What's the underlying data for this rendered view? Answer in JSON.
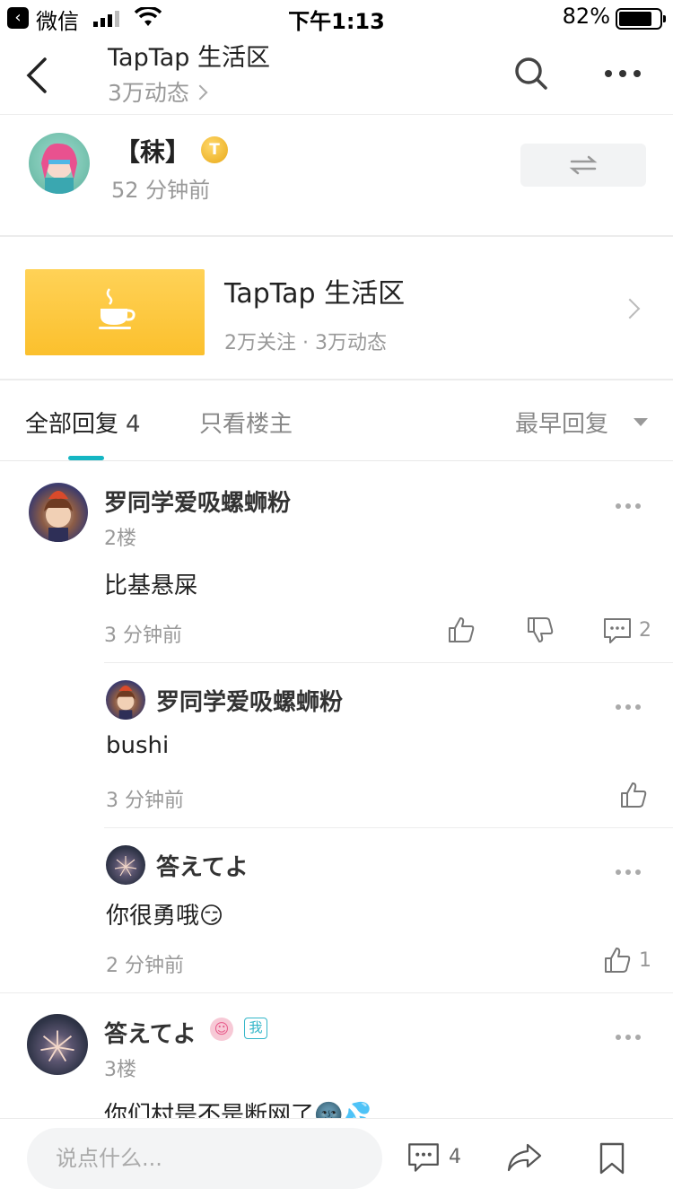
{
  "status_bar": {
    "back_app": "微信",
    "time": "下午1:13",
    "battery_pct": "82%",
    "battery_level": 0.82
  },
  "header": {
    "title": "TapTap 生活区",
    "subtitle": "3万动态"
  },
  "author": {
    "name": "【秣】",
    "badge": "T",
    "time": "52 分钟前"
  },
  "forum": {
    "title": "TapTap 生活区",
    "meta": "2万关注 · 3万动态"
  },
  "tabs": {
    "all": "全部回复",
    "all_count": "4",
    "owner_only": "只看楼主",
    "sort": "最早回复"
  },
  "comments": [
    {
      "user": "罗同学爱吸螺蛳粉",
      "floor": "2楼",
      "text": "比基悬屎",
      "time": "3 分钟前",
      "reply_count": "2"
    },
    {
      "user": "答えてよ",
      "floor": "3楼",
      "text": "你们村是不是断网了🌚💦",
      "me_tag": "我"
    }
  ],
  "replies": [
    {
      "user": "罗同学爱吸螺蛳粉",
      "text": "bushi",
      "time": "3 分钟前"
    },
    {
      "user": "答えてよ",
      "text": "你很勇哦😏",
      "time": "2 分钟前",
      "likes": "1"
    }
  ],
  "bottom_bar": {
    "placeholder": "说点什么...",
    "comment_count": "4"
  },
  "colors": {
    "accent": "#15b6c3",
    "forum_thumb": "#fbc02d",
    "me_tag": "#34b6c9"
  },
  "icons": [
    "back-icon",
    "search-icon",
    "more-icon",
    "swap-icon",
    "coffee-cup-icon",
    "chevron-right-icon",
    "thumbs-up-icon",
    "thumbs-down-icon",
    "comment-icon",
    "share-icon",
    "bookmark-icon"
  ]
}
